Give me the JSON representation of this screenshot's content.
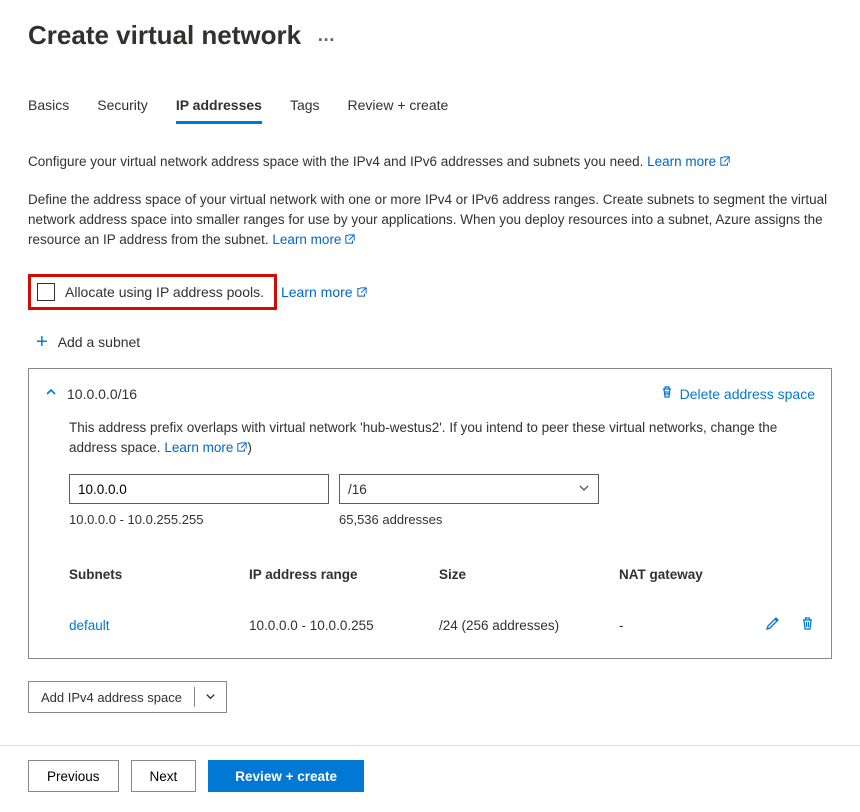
{
  "header": {
    "title": "Create virtual network",
    "more": "…"
  },
  "tabs": {
    "items": [
      "Basics",
      "Security",
      "IP addresses",
      "Tags",
      "Review + create"
    ],
    "active_index": 2
  },
  "intro1": "Configure your virtual network address space with the IPv4 and IPv6 addresses and subnets you need.",
  "intro2": "Define the address space of your virtual network with one or more IPv4 or IPv6 address ranges. Create subnets to segment the virtual network address space into smaller ranges for use by your applications. When you deploy resources into a subnet, Azure assigns the resource an IP address from the subnet.",
  "learn_more": "Learn more",
  "allocate_label": "Allocate using IP address pools.",
  "add_subnet_label": "Add a subnet",
  "addr_space": {
    "cidr": "10.0.0.0/16",
    "delete_label": "Delete address space",
    "overlap_warning": "This address prefix overlaps with virtual network 'hub-westus2'. If you intend to peer these virtual networks, change the address space.",
    "ip_value": "10.0.0.0",
    "prefix_value": "/16",
    "range_text": "10.0.0.0 - 10.0.255.255",
    "count_text": "65,536 addresses"
  },
  "subnet_table": {
    "headers": [
      "Subnets",
      "IP address range",
      "Size",
      "NAT gateway"
    ],
    "rows": [
      {
        "name": "default",
        "range": "10.0.0.0 - 10.0.0.255",
        "size": "/24 (256 addresses)",
        "nat": "-"
      }
    ]
  },
  "add_space_label": "Add IPv4 address space",
  "footer": {
    "previous": "Previous",
    "next": "Next",
    "review": "Review + create"
  }
}
